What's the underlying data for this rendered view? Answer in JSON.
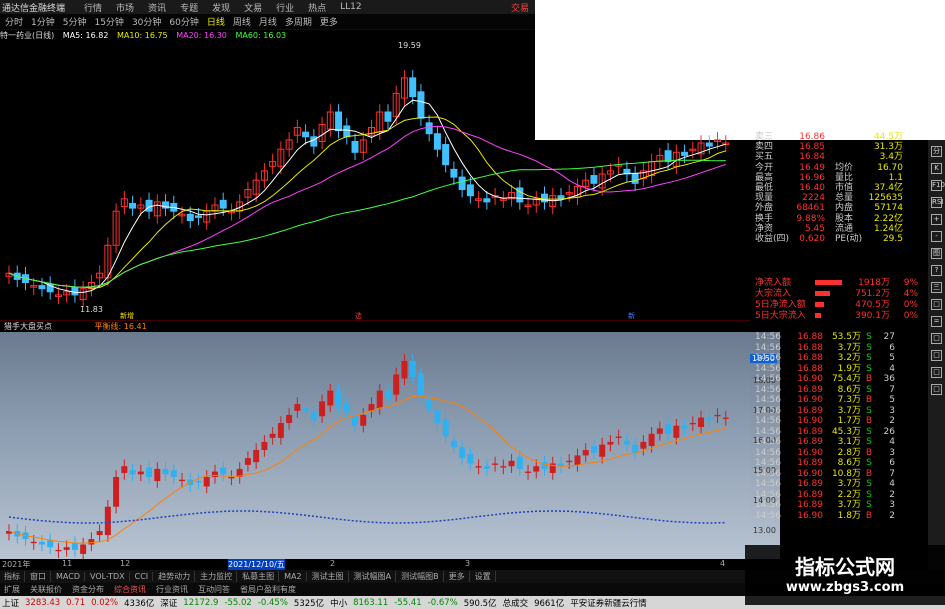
{
  "topbar": {
    "app": "通达信金融终端",
    "menus": [
      "行情",
      "市场",
      "资讯",
      "专题",
      "发现",
      "文易",
      "行业",
      "热点",
      "LL12"
    ],
    "trade": "交易"
  },
  "periods": [
    {
      "label": "分时",
      "active": false
    },
    {
      "label": "1分钟",
      "active": false
    },
    {
      "label": "5分钟",
      "active": false
    },
    {
      "label": "15分钟",
      "active": false
    },
    {
      "label": "30分钟",
      "active": false
    },
    {
      "label": "60分钟",
      "active": false
    },
    {
      "label": "日线",
      "active": true
    },
    {
      "label": "周线",
      "active": false
    },
    {
      "label": "月线",
      "active": false
    },
    {
      "label": "多周期",
      "active": false
    },
    {
      "label": "更多",
      "active": false
    }
  ],
  "ma": {
    "title": "特一药业(日线)",
    "items": [
      {
        "label": "MA5: 16.82",
        "color": "#ffffff"
      },
      {
        "label": "MA10: 16.75",
        "color": "#e8e800"
      },
      {
        "label": "MA20: 16.30",
        "color": "#ff40ff"
      },
      {
        "label": "MA60: 16.03",
        "color": "#40ff40"
      }
    ]
  },
  "main_chart": {
    "high_label": "19.59",
    "low_label": "11.83",
    "price_axis": [
      "17.00",
      "16.50",
      "16.00",
      "15.50",
      "15.00",
      "14.50",
      "14.00",
      "13.50",
      "13.00",
      "12.50",
      "12.00"
    ],
    "markers": [
      "新增",
      "选",
      "新"
    ]
  },
  "sub_chart": {
    "title": "猎手大盘买点",
    "indicator": "平衡线: 16.41",
    "axis_tag": "18.50",
    "price_axis": [
      "18.00",
      "17.00",
      "16.00",
      "15.00",
      "14.00",
      "13.00"
    ]
  },
  "date_axis": {
    "year": "2021年",
    "labels": [
      "11",
      "12",
      "2021/12/10/五",
      "2",
      "3",
      "4"
    ]
  },
  "quote": {
    "asks": [
      {
        "k": "卖三",
        "v": "16.86",
        "n": "44.5万"
      },
      {
        "k": "卖四",
        "v": "16.85",
        "n": "31.3万"
      },
      {
        "k": "买五",
        "v": "16.84",
        "n": "3.4万"
      }
    ],
    "stats": [
      {
        "k": "今开",
        "v": "16.49",
        "k2": "均价",
        "v2": "16.70"
      },
      {
        "k": "最高",
        "v": "16.96",
        "k2": "量比",
        "v2": "1.1"
      },
      {
        "k": "最低",
        "v": "16.40",
        "k2": "市值",
        "v2": "37.4亿"
      },
      {
        "k": "现量",
        "v": "2224",
        "k2": "总量",
        "v2": "125635"
      },
      {
        "k": "外盘",
        "v": "68461",
        "k2": "内盘",
        "v2": "57174"
      },
      {
        "k": "换手",
        "v": "9.88%",
        "k2": "股本",
        "v2": "2.22亿"
      },
      {
        "k": "净资",
        "v": "5.45",
        "k2": "流通",
        "v2": "1.24亿"
      },
      {
        "k": "收益(四)",
        "v": "0.620",
        "k2": "PE(动)",
        "v2": "29.5"
      }
    ],
    "flows": [
      {
        "k": "净流入额",
        "bar": 0.9,
        "v": "1918万",
        "p": "9%"
      },
      {
        "k": "大宗流入",
        "bar": 0.5,
        "v": "751.2万",
        "p": "4%"
      },
      {
        "k": "5日净流入额",
        "bar": 0.3,
        "v": "470.5万",
        "p": "0%"
      },
      {
        "k": "5日大宗流入",
        "bar": 0.2,
        "v": "390.1万",
        "p": "0%"
      }
    ]
  },
  "ticks": [
    {
      "t": "14:56",
      "p": "16.88",
      "vol": "53.5万",
      "bs": "S",
      "n": "27"
    },
    {
      "t": "14:56",
      "p": "16.88",
      "vol": "3.7万",
      "bs": "S",
      "n": "6"
    },
    {
      "t": "14:56",
      "p": "16.88",
      "vol": "3.2万",
      "bs": "S",
      "n": "5"
    },
    {
      "t": "14:56",
      "p": "16.88",
      "vol": "1.9万",
      "bs": "S",
      "n": "4"
    },
    {
      "t": "14:56",
      "p": "16.90",
      "vol": "75.4万",
      "bs": "B",
      "n": "36"
    },
    {
      "t": "14:56",
      "p": "16.89",
      "vol": "8.6万",
      "bs": "S",
      "n": "7"
    },
    {
      "t": "14:56",
      "p": "16.90",
      "vol": "7.3万",
      "bs": "B",
      "n": "5"
    },
    {
      "t": "14:56",
      "p": "16.89",
      "vol": "3.7万",
      "bs": "S",
      "n": "3"
    },
    {
      "t": "14:56",
      "p": "16.90",
      "vol": "1.7万",
      "bs": "B",
      "n": "2"
    },
    {
      "t": "14:56",
      "p": "16.89",
      "vol": "45.3万",
      "bs": "S",
      "n": "26"
    },
    {
      "t": "14:56",
      "p": "16.89",
      "vol": "3.1万",
      "bs": "S",
      "n": "4"
    },
    {
      "t": "14:56",
      "p": "16.90",
      "vol": "2.8万",
      "bs": "B",
      "n": "3"
    },
    {
      "t": "14:56",
      "p": "16.89",
      "vol": "8.6万",
      "bs": "S",
      "n": "6"
    },
    {
      "t": "14:56",
      "p": "16.90",
      "vol": "10.8万",
      "bs": "B",
      "n": "7"
    },
    {
      "t": "14:56",
      "p": "16.89",
      "vol": "3.7万",
      "bs": "S",
      "n": "4"
    },
    {
      "t": "14:56",
      "p": "16.89",
      "vol": "2.2万",
      "bs": "S",
      "n": "2"
    },
    {
      "t": "14:56",
      "p": "16.89",
      "vol": "3.7万",
      "bs": "S",
      "n": "3"
    },
    {
      "t": "14:56",
      "p": "16.90",
      "vol": "1.8万",
      "bs": "B",
      "n": "2"
    }
  ],
  "tabs": [
    {
      "label": "指标",
      "active": false
    },
    {
      "label": "窗口",
      "active": false
    },
    {
      "label": "MACD",
      "active": false
    },
    {
      "label": "VOL-TDX",
      "active": false
    },
    {
      "label": "CCI",
      "active": false
    },
    {
      "label": "趋势动力",
      "active": false
    },
    {
      "label": "主力监控",
      "active": false
    },
    {
      "label": "私募主图",
      "active": false
    },
    {
      "label": "MA2",
      "active": false
    },
    {
      "label": "测试主图",
      "active": false
    },
    {
      "label": "测试幅图A",
      "active": false
    },
    {
      "label": "测试幅图B",
      "active": false
    },
    {
      "label": "更多",
      "active": false
    },
    {
      "label": "设置",
      "active": false
    }
  ],
  "ext_tabs": [
    {
      "label": "扩展",
      "hl": false
    },
    {
      "label": "关联报价",
      "hl": false
    },
    {
      "label": "资金分布",
      "hl": false
    },
    {
      "label": "综合资讯",
      "hl": true
    },
    {
      "label": "行业资讯",
      "hl": false
    },
    {
      "label": "互动问答",
      "hl": false
    },
    {
      "label": "省局户盈利有度",
      "hl": false
    }
  ],
  "status": {
    "sh_label": "上证",
    "sh_val": "3283.43",
    "sh_chg": "0.71",
    "sh_pct": "0.02%",
    "sh_amt": "4336亿",
    "sz_label": "深证",
    "sz_val": "12172.9",
    "sz_chg": "-55.02",
    "sz_pct": "-0.45%",
    "sz_amt": "5325亿",
    "zx_label": "中小",
    "zx_val": "8163.11",
    "zx_chg": "-55.41",
    "zx_pct": "-0.67%",
    "zx_amt": "590.5亿",
    "total_label": "总成交",
    "total_amt": "9661亿",
    "broker": "平安证券新疆云行情"
  },
  "sidebar_icons": [
    "分",
    "K",
    "F10",
    "RSI",
    "+",
    "-",
    "图",
    "?",
    "三",
    "□",
    "=",
    "□",
    "□",
    "□",
    "□"
  ],
  "watermark": {
    "line1": "指标公式网",
    "line2": "www.zbgs3.com"
  },
  "colors": {
    "up": "#ff3030",
    "down": "#40c0ff",
    "ma5": "#ffffff",
    "ma10": "#e8e800",
    "ma20": "#ff40ff",
    "ma60": "#40ff40"
  }
}
